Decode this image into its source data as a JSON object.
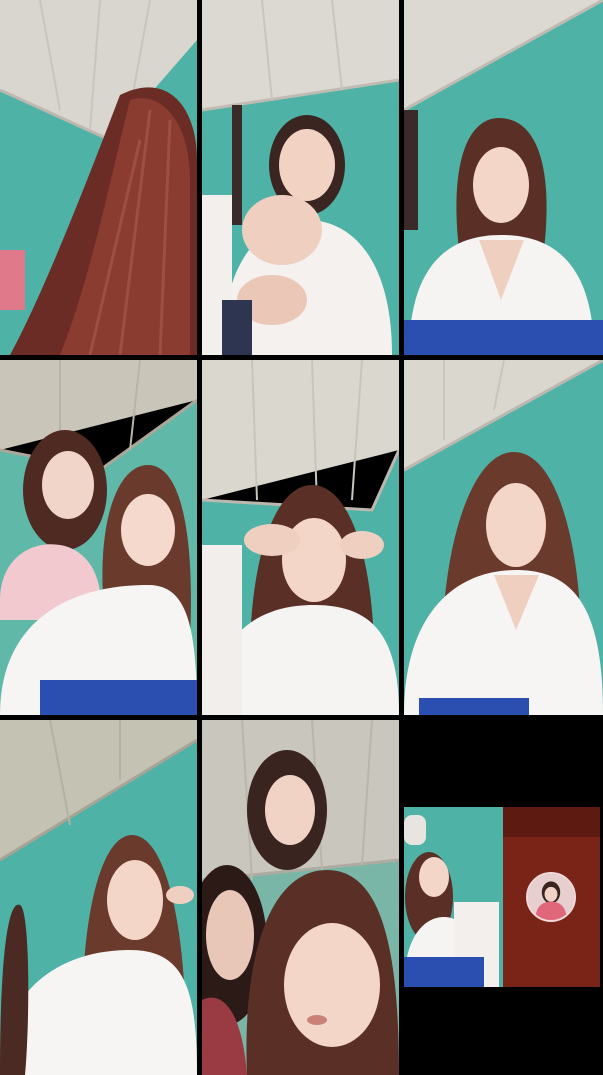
{
  "call": {
    "layout": "video-grid-3x3",
    "tiles": [
      {
        "id": 1,
        "scene": "hair-close-up",
        "wall_color": "#4fb2a6"
      },
      {
        "id": 2,
        "scene": "person-waving",
        "wall_color": "#4fb2a6"
      },
      {
        "id": 3,
        "scene": "person-seated",
        "wall_color": "#4fb2a6"
      },
      {
        "id": 4,
        "scene": "two-people",
        "wall_color": "#5fb8a8"
      },
      {
        "id": 5,
        "scene": "person-hands-on-head",
        "wall_color": "#4fb2a6"
      },
      {
        "id": 6,
        "scene": "person-seated",
        "wall_color": "#4fb2a6"
      },
      {
        "id": 7,
        "scene": "person-with-finger-at-lips",
        "wall_color": "#4fb2a6"
      },
      {
        "id": 8,
        "scene": "three-people-close-up",
        "wall_color": "#7ab6a7"
      },
      {
        "id": 9,
        "scene": "empty-black",
        "wall_color": "#000000"
      }
    ],
    "self_view": {
      "scene": "person-seated",
      "wall_color": "#4fb2a6"
    },
    "remote_view": {
      "background_color": "#7a2418",
      "avatar_icon": "profile-avatar-icon"
    }
  }
}
